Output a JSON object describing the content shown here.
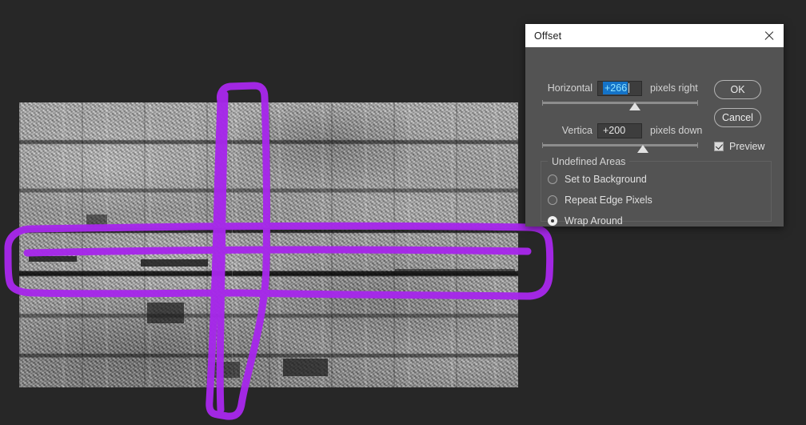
{
  "app": {
    "background_color": "#272727",
    "ink_color": "#a628ea"
  },
  "canvas": {
    "image_name": "stone-wall-grayscale-photo"
  },
  "dialog": {
    "title": "Offset",
    "close_icon": "close-icon",
    "horizontal": {
      "label": "Horizontal",
      "value": "+266",
      "unit": "pixels right",
      "selected": true
    },
    "vertical": {
      "label": "Vertica",
      "value": "+200",
      "unit": "pixels down",
      "selected": false
    },
    "buttons": {
      "ok": "OK",
      "cancel": "Cancel"
    },
    "preview": {
      "label": "Preview",
      "checked": true
    },
    "undefined_areas": {
      "legend": "Undefined Areas",
      "options": [
        {
          "label": "Set to Background",
          "selected": false
        },
        {
          "label": "Repeat Edge Pixels",
          "selected": false
        },
        {
          "label": "Wrap Around",
          "selected": true
        }
      ]
    }
  },
  "annotations": {
    "vertical_highlight": "vertical-column-circle",
    "horizontal_highlight": "horizontal-band-circle",
    "fields_highlight": "offset-fields-circle"
  }
}
